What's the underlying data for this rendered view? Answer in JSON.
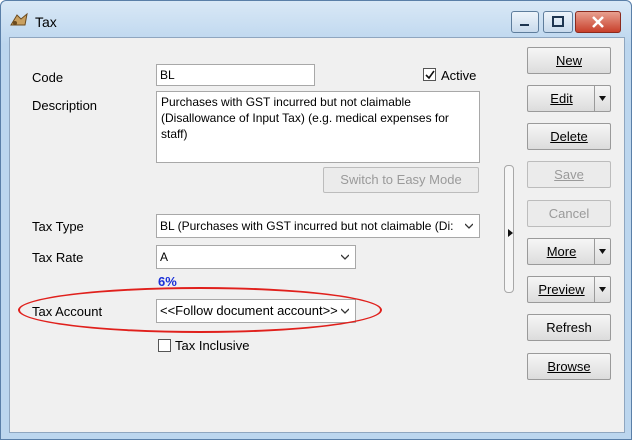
{
  "window": {
    "title": "Tax"
  },
  "form": {
    "code_label": "Code",
    "code_value": "BL",
    "active_label": "Active",
    "active_checked": true,
    "description_label": "Description",
    "description_value": "Purchases with GST incurred but not claimable (Disallowance of Input Tax) (e.g. medical expenses for staff)",
    "switch_mode_label": "Switch to Easy Mode",
    "tax_type_label": "Tax Type",
    "tax_type_value": "BL (Purchases with GST incurred but not claimable (Di:",
    "tax_rate_label": "Tax Rate",
    "tax_rate_value": "A",
    "tax_rate_percent": "6%",
    "tax_account_label": "Tax Account",
    "tax_account_value": "<<Follow document account>>",
    "tax_inclusive_label": "Tax Inclusive",
    "tax_inclusive_checked": false
  },
  "side_buttons": {
    "new": "New",
    "edit": "Edit",
    "delete": "Delete",
    "save": "Save",
    "cancel": "Cancel",
    "more": "More",
    "preview": "Preview",
    "refresh": "Refresh",
    "browse": "Browse"
  },
  "colors": {
    "highlight_ellipse": "#e0201c",
    "rate_text": "#1a2fd8"
  }
}
